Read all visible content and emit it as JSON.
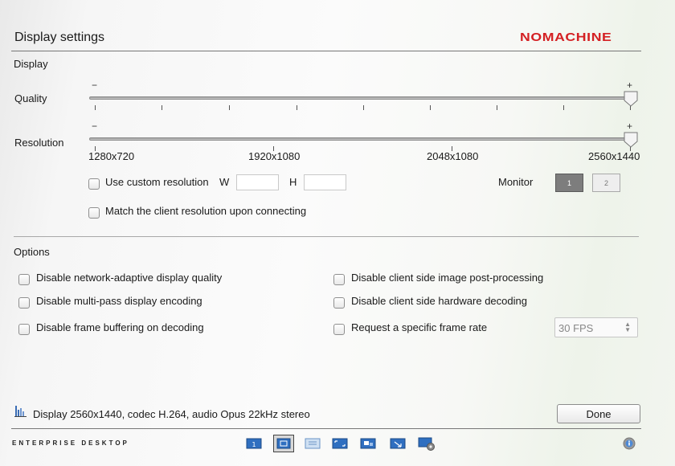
{
  "header": {
    "title": "Display settings",
    "logo": "NOMACHINE"
  },
  "display": {
    "section_label": "Display",
    "quality": {
      "label": "Quality",
      "minus": "−",
      "plus": "+",
      "level": 1.0
    },
    "resolution": {
      "label": "Resolution",
      "minus": "−",
      "plus": "+",
      "ticks": [
        "1280x720",
        "1920x1080",
        "2048x1080",
        "2560x1440"
      ],
      "selected": "2560x1440"
    },
    "custom_resolution": {
      "label": "Use custom resolution",
      "w_label": "W",
      "h_label": "H",
      "w_value": "",
      "h_value": ""
    },
    "monitor": {
      "label": "Monitor",
      "buttons": [
        "1",
        "2"
      ],
      "selected": "1"
    },
    "match_client": {
      "label": "Match the client resolution upon connecting"
    }
  },
  "options": {
    "section_label": "Options",
    "left": [
      "Disable network-adaptive display quality",
      "Disable multi-pass display encoding",
      "Disable frame buffering on decoding"
    ],
    "right": [
      "Disable client side image post-processing",
      "Disable client side hardware decoding",
      "Request a specific frame rate"
    ],
    "frame_rate_select": "30 FPS"
  },
  "status": {
    "text": "Display 2560x1440, codec H.264, audio Opus 22kHz stereo",
    "icon": "bar-chart-icon"
  },
  "done_label": "Done",
  "footer": {
    "brand": "ENTERPRISE DESKTOP",
    "toolbar_icons": [
      "monitor-1-icon",
      "fit-display-icon",
      "fullscreen-icon",
      "scale-icon",
      "viewport-icon",
      "resize-icon",
      "display-settings-icon",
      "info-icon"
    ]
  },
  "colors": {
    "brand": "#d42023",
    "monitor_active": "#7d7d7d"
  }
}
